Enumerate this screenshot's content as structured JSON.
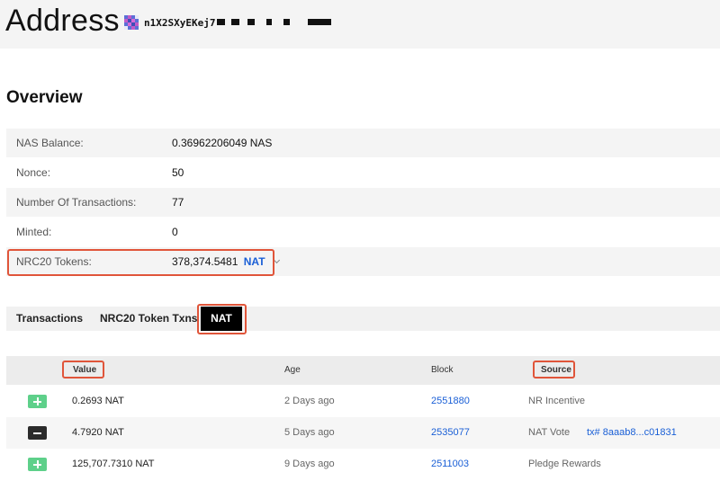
{
  "page": {
    "title": "Address",
    "address": "n1X2SXyEKej7"
  },
  "overview": {
    "title": "Overview",
    "rows": [
      {
        "label": "NAS Balance:",
        "value": "0.36962206049 NAS"
      },
      {
        "label": "Nonce:",
        "value": "50"
      },
      {
        "label": "Number Of Transactions:",
        "value": "77"
      },
      {
        "label": "Minted:",
        "value": "0"
      },
      {
        "label": "NRC20 Tokens:",
        "value": "378,374.5481",
        "token": "NAT"
      }
    ]
  },
  "tabs": {
    "transactions": "Transactions",
    "nrc20": "NRC20 Token Txns",
    "nat": "NAT"
  },
  "table": {
    "headers": {
      "value": "Value",
      "age": "Age",
      "block": "Block",
      "source": "Source"
    },
    "rows": [
      {
        "sign": "plus",
        "value": "0.2693 NAT",
        "age": "2 Days ago",
        "block": "2551880",
        "source": "NR Incentive",
        "tx": ""
      },
      {
        "sign": "minus",
        "value": "4.7920 NAT",
        "age": "5 Days ago",
        "block": "2535077",
        "source": "NAT Vote",
        "tx": "tx# 8aaab8...c01831"
      },
      {
        "sign": "plus",
        "value": "125,707.7310 NAT",
        "age": "9 Days ago",
        "block": "2511003",
        "source": "Pledge Rewards",
        "tx": ""
      }
    ]
  },
  "colors": {
    "link": "#1a5fd6",
    "highlight": "#e0553a",
    "plus": "#5ed08a",
    "minus": "#2b2b2b",
    "active_tab": "#000000"
  },
  "icons": {
    "avatar": "address-avatar-icon",
    "dropdown": "chevron-down-icon",
    "incoming": "plus-icon",
    "outgoing": "minus-icon"
  }
}
